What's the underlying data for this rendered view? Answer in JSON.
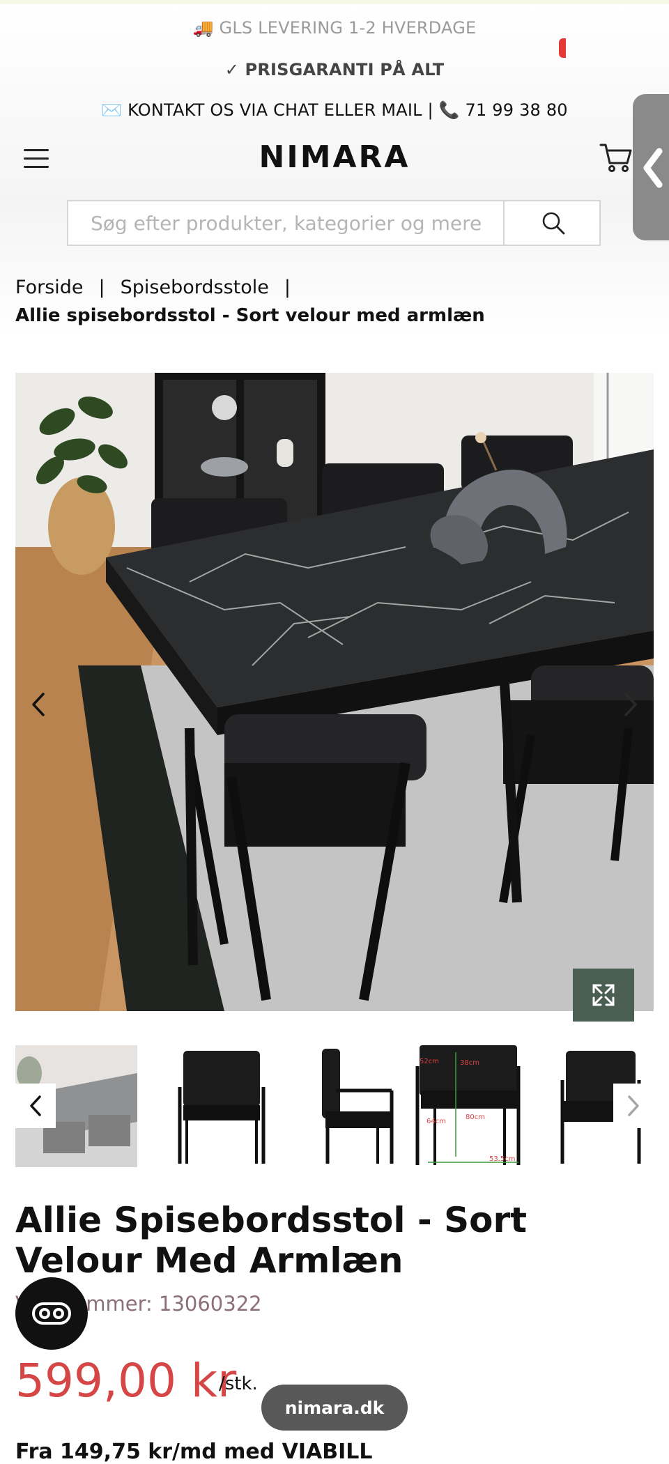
{
  "announcements": {
    "delivery": "🚚 GLS LEVERING 1-2 HVERDAGE",
    "guarantee": "✓ PRISGARANTI PÅ ALT",
    "contact": "✉️ KONTAKT OS VIA CHAT ELLER MAIL | 📞 71 99 38 80"
  },
  "header": {
    "logo": "NIMARA",
    "menu_icon": "hamburger-menu-icon",
    "cart_icon": "shopping-cart-icon",
    "side_tab_icon": "chevron-left-icon"
  },
  "search": {
    "placeholder": "Søg efter produkter, kategorier og mere",
    "value": "",
    "icon": "search-icon"
  },
  "breadcrumb": {
    "items": [
      "Forside",
      "Spisebordsstole"
    ],
    "separator": "|",
    "current": "Allie spisebordsstol - Sort velour med armlæn"
  },
  "gallery": {
    "prev_icon": "chevron-left-icon",
    "next_icon": "chevron-right-icon",
    "zoom_icon": "expand-icon",
    "thumbnail_count": 5
  },
  "dimension_labels": [
    "52cm",
    "38cm",
    "64cm",
    "80cm",
    "53.5cm"
  ],
  "product": {
    "title": "Allie Spisebordsstol - Sort Velour Med Armlæn",
    "item_number": "Varenummer: 13060322",
    "price": "599,00 kr",
    "unit": "/stk.",
    "cutoff_text": "Fra 149,75 kr/md med VIABILL"
  },
  "browser": {
    "url_pill": "nimara.dk"
  },
  "chat_widget": {
    "icon": "chat-toggle-icon"
  },
  "colors": {
    "price": "#d54646",
    "zoom_button": "#4a5e52",
    "side_tab": "#8a8a8a",
    "item_number": "#8c6f7a"
  }
}
